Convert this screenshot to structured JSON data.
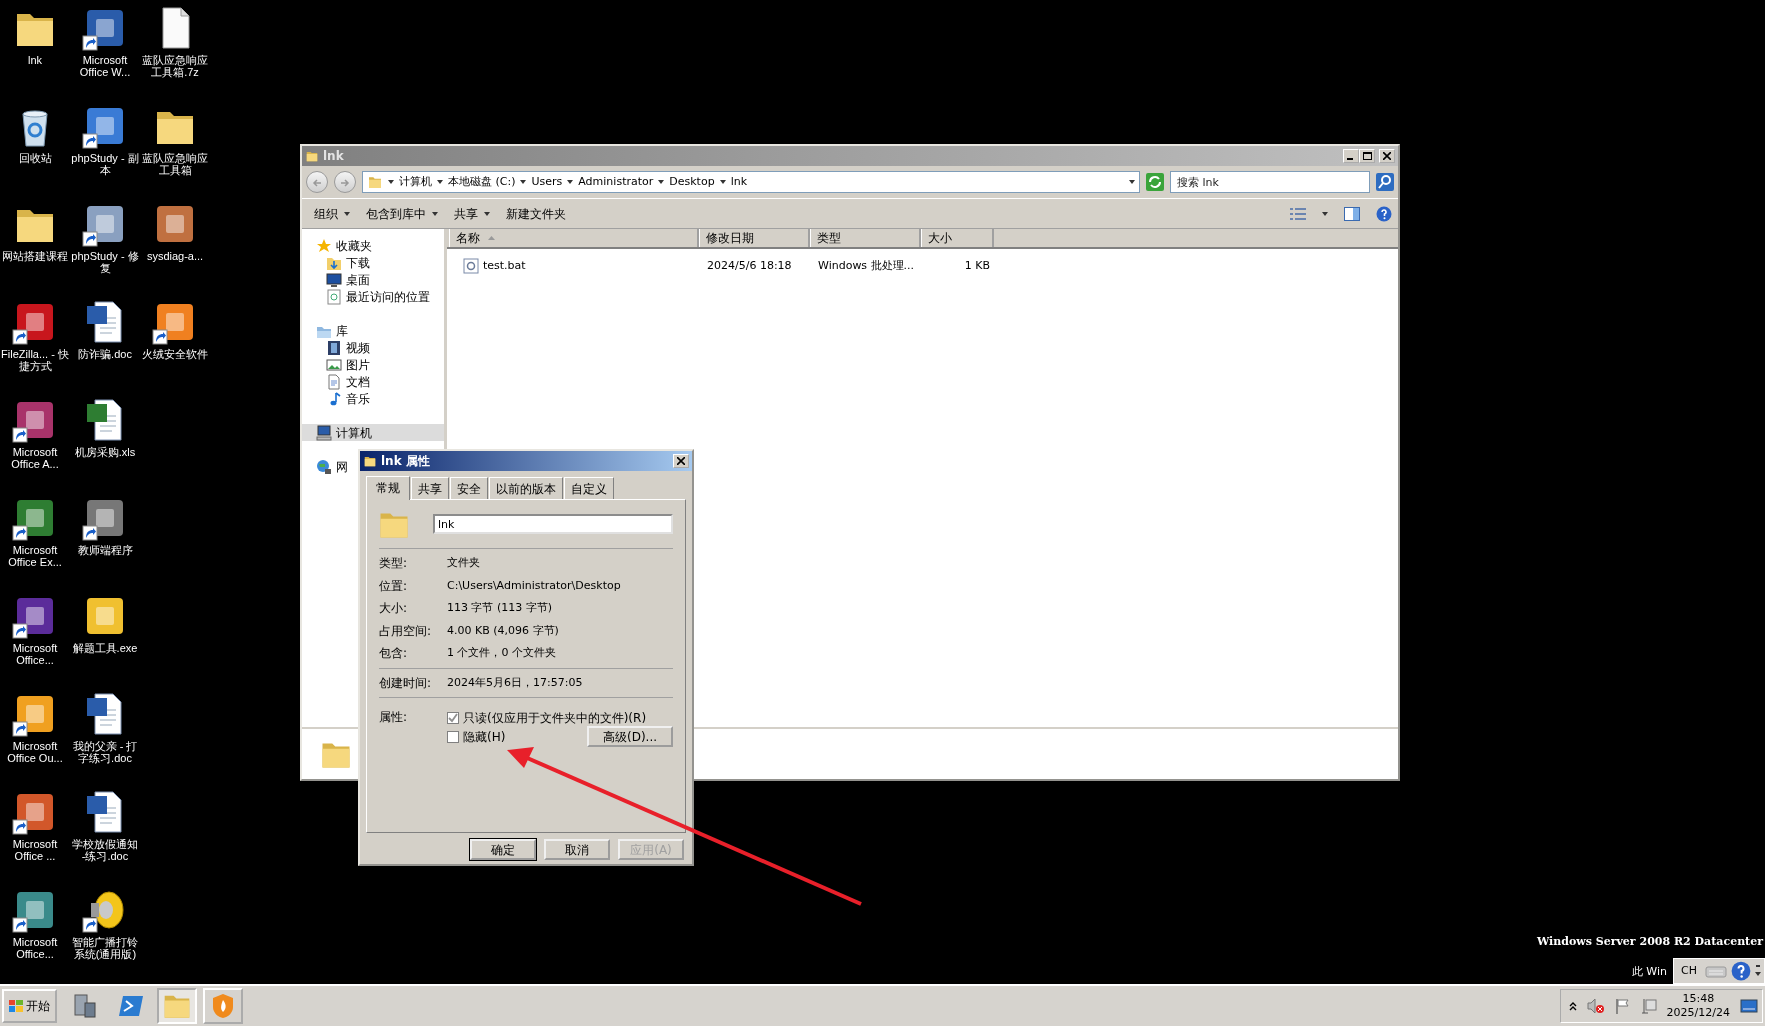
{
  "desktop": {
    "icons": [
      {
        "label": "lnk",
        "kind": "folder",
        "shortcut": false
      },
      {
        "label": "回收站",
        "kind": "bin",
        "shortcut": false
      },
      {
        "label": "网站搭建课程",
        "kind": "folder",
        "shortcut": false
      },
      {
        "label": "FileZilla... - 快捷方式",
        "kind": "app",
        "color": "#c8161d",
        "shortcut": true
      },
      {
        "label": "Microsoft Office A...",
        "kind": "app",
        "color": "#a8336a",
        "shortcut": true
      },
      {
        "label": "Microsoft Office Ex...",
        "kind": "app",
        "color": "#2e7d32",
        "shortcut": true
      },
      {
        "label": "Microsoft Office...",
        "kind": "app",
        "color": "#5b2c9a",
        "shortcut": true
      },
      {
        "label": "Microsoft Office Ou...",
        "kind": "app",
        "color": "#f0a020",
        "shortcut": true
      },
      {
        "label": "Microsoft Office ...",
        "kind": "app",
        "color": "#d2572a",
        "shortcut": true
      },
      {
        "label": "Microsoft Office...",
        "kind": "app",
        "color": "#3a8a8a",
        "shortcut": true
      },
      {
        "label": "Microsoft Office W...",
        "kind": "app",
        "color": "#2a5caa",
        "shortcut": true
      },
      {
        "label": "phpStudy - 副本",
        "kind": "app",
        "color": "#3a7bd5",
        "shortcut": true
      },
      {
        "label": "phpStudy - 修复",
        "kind": "app",
        "color": "#8aa0c0",
        "shortcut": true
      },
      {
        "label": "防诈骗.doc",
        "kind": "document",
        "color": "#2a5caa",
        "shortcut": false
      },
      {
        "label": "机房采购.xls",
        "kind": "document",
        "color": "#2e7d32",
        "shortcut": false
      },
      {
        "label": "教师端程序",
        "kind": "app",
        "color": "#777777",
        "shortcut": true
      },
      {
        "label": "解题工具.exe",
        "kind": "app",
        "color": "#f0c030",
        "shortcut": false
      },
      {
        "label": "我的父亲 - 打字练习.doc",
        "kind": "document",
        "color": "#2a5caa",
        "shortcut": false
      },
      {
        "label": "学校放假通知 -练习.doc",
        "kind": "document",
        "color": "#2a5caa",
        "shortcut": false
      },
      {
        "label": "智能广播打铃系统(通用版)",
        "kind": "speaker",
        "shortcut": true
      },
      {
        "label": "蓝队应急响应工具箱.7z",
        "kind": "file",
        "shortcut": false
      },
      {
        "label": "蓝队应急响应工具箱",
        "kind": "folder",
        "shortcut": false
      },
      {
        "label": "sysdiag-a...",
        "kind": "app",
        "color": "#c07040",
        "shortcut": false
      },
      {
        "label": "火绒安全软件",
        "kind": "app",
        "color": "#f08020",
        "shortcut": true
      }
    ]
  },
  "explorer": {
    "title": "lnk",
    "breadcrumbs": [
      "计算机",
      "本地磁盘 (C:)",
      "Users",
      "Administrator",
      "Desktop",
      "lnk"
    ],
    "search": {
      "placeholder": "搜索 lnk"
    },
    "toolbar": [
      {
        "label": "组织",
        "dropdown": true
      },
      {
        "label": "包含到库中",
        "dropdown": true
      },
      {
        "label": "共享",
        "dropdown": true
      },
      {
        "label": "新建文件夹",
        "dropdown": false
      }
    ],
    "nav": [
      {
        "label": "收藏夹",
        "kind": "star",
        "selected": false,
        "children": [
          {
            "label": "下载",
            "kind": "download",
            "selected": false
          },
          {
            "label": "桌面",
            "kind": "desktop",
            "selected": false
          },
          {
            "label": "最近访问的位置",
            "kind": "recent",
            "selected": false
          }
        ]
      },
      {
        "label": "库",
        "kind": "library",
        "selected": false,
        "children": [
          {
            "label": "视频",
            "kind": "video",
            "selected": false
          },
          {
            "label": "图片",
            "kind": "picture",
            "selected": false
          },
          {
            "label": "文档",
            "kind": "document",
            "selected": false
          },
          {
            "label": "音乐",
            "kind": "music",
            "selected": false
          }
        ]
      },
      {
        "label": "计算机",
        "kind": "computer",
        "selected": true
      },
      {
        "label": "网",
        "kind": "network",
        "selected": false
      }
    ],
    "columns": [
      {
        "label": "名称",
        "sorted": true
      },
      {
        "label": "修改日期",
        "sorted": false
      },
      {
        "label": "类型",
        "sorted": false
      },
      {
        "label": "大小",
        "sorted": false
      }
    ],
    "rows": [
      {
        "cells": [
          "test.bat",
          "2024/5/6 18:18",
          "Windows 批处理...",
          "1 KB"
        ]
      }
    ]
  },
  "dialog": {
    "title": "lnk 属性",
    "tabs": [
      {
        "label": "常规",
        "selected": true
      },
      {
        "label": "共享",
        "selected": false
      },
      {
        "label": "安全",
        "selected": false
      },
      {
        "label": "以前的版本",
        "selected": false
      },
      {
        "label": "自定义",
        "selected": false
      }
    ],
    "name_value": "lnk",
    "sections": [
      [
        {
          "label": "类型:",
          "value": "文件夹"
        },
        {
          "label": "位置:",
          "value": "C:\\Users\\Administrator\\Desktop"
        },
        {
          "label": "大小:",
          "value": "113 字节 (113 字节)"
        },
        {
          "label": "占用空间:",
          "value": "4.00 KB (4,096 字节)"
        },
        {
          "label": "包含:",
          "value": "1 个文件，0 个文件夹"
        }
      ],
      [
        {
          "label": "创建时间:",
          "value": "2024年5月6日，17:57:05"
        }
      ]
    ],
    "attributes_label": "属性:",
    "attributes": [
      {
        "label": "只读(仅应用于文件夹中的文件)(R)",
        "checked": true
      },
      {
        "label": "隐藏(H)",
        "checked": false
      }
    ],
    "advanced_button": "高级(D)...",
    "buttons": [
      {
        "label": "确定",
        "default": true,
        "disabled": false
      },
      {
        "label": "取消",
        "default": false,
        "disabled": false
      },
      {
        "label": "应用(A)",
        "default": false,
        "disabled": true
      }
    ]
  },
  "taskbar": {
    "start": "开始",
    "quick_launch": [
      {
        "kind": "server"
      },
      {
        "kind": "terminal"
      }
    ],
    "tasks": [
      {
        "kind": "folder",
        "active": true
      },
      {
        "kind": "shield",
        "active": false
      }
    ],
    "tray": {
      "time": "15:48",
      "date": "2025/12/24"
    }
  },
  "language_bar": {
    "language": "CH"
  },
  "os_text": {
    "edition": "Windows Server 2008 R2 Datacenter",
    "partial": "此 Win"
  }
}
